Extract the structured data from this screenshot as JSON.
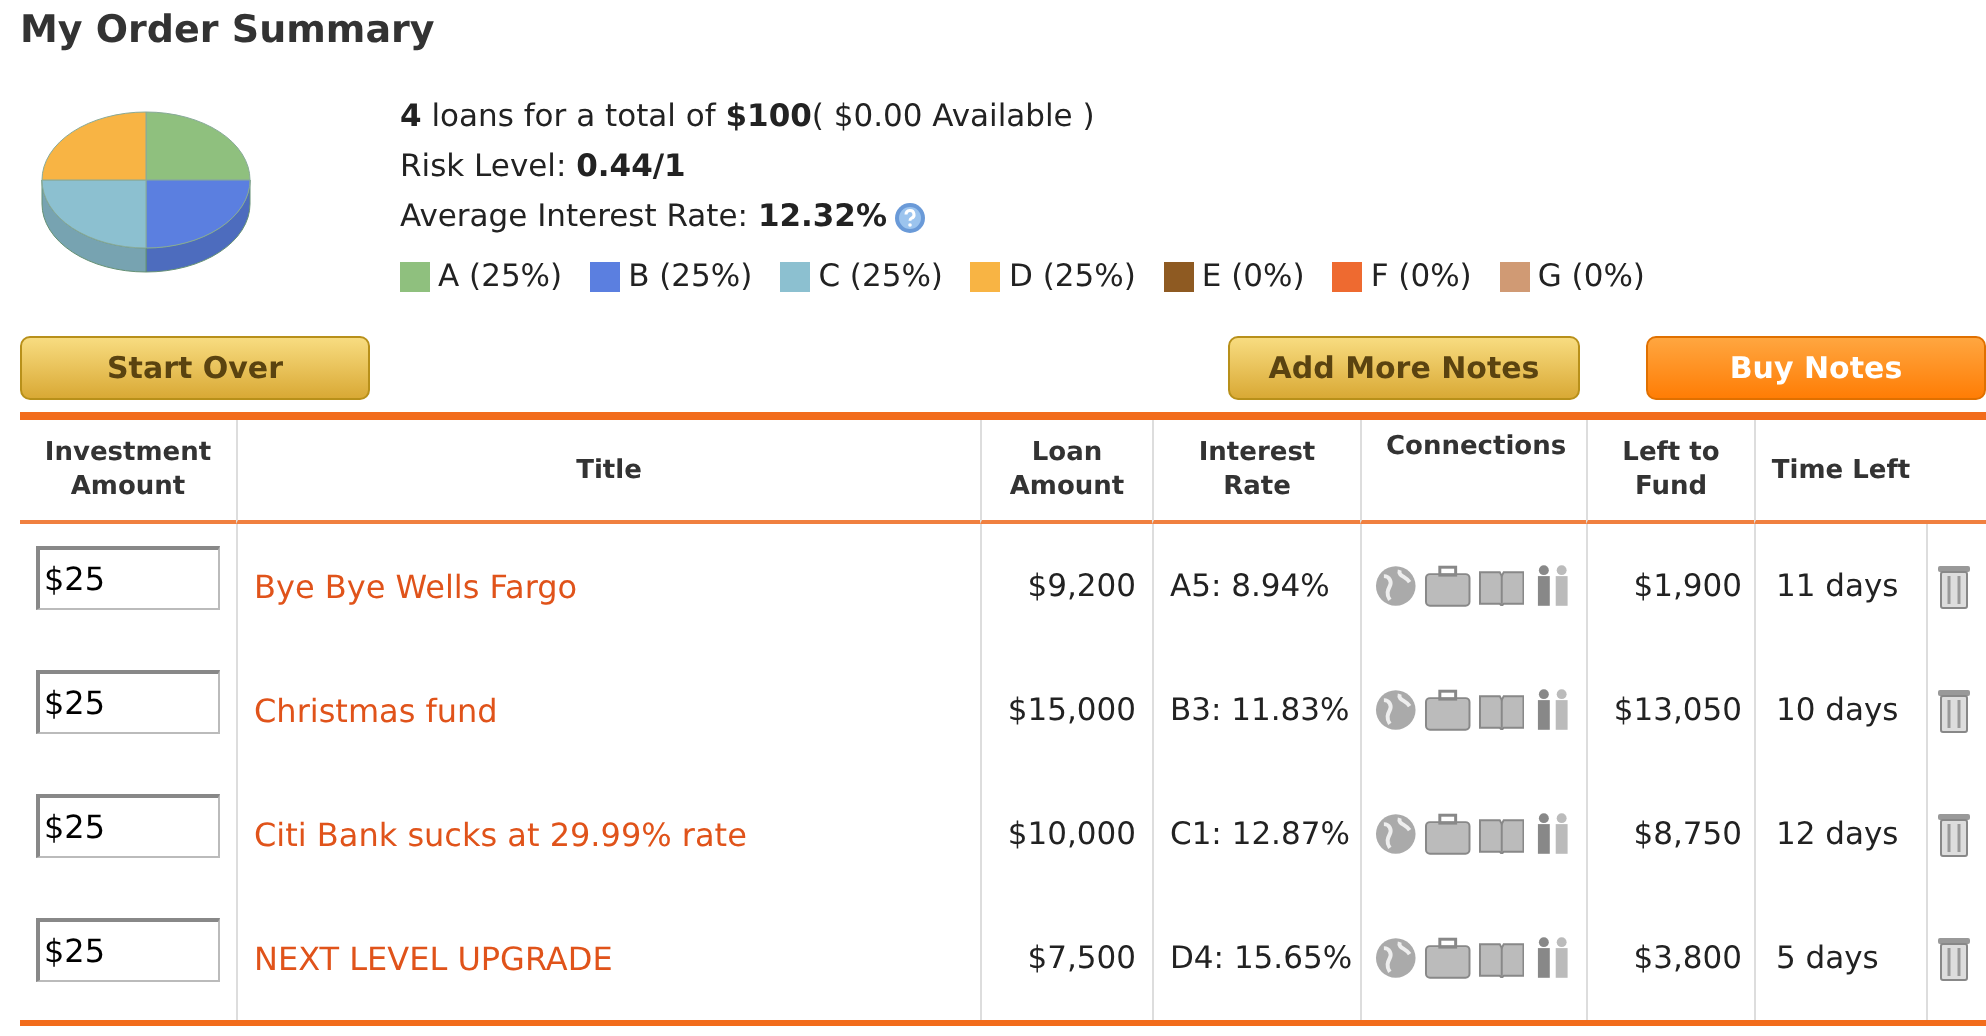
{
  "title": "My Order Summary",
  "summary": {
    "lines": [
      "**4** loans for a total of **$100**( $0.00 Available )",
      "Risk Level: **0.44/1**",
      "Average Interest Rate: **12.32%**"
    ],
    "legend": [
      {
        "label": "A (25%)",
        "color": "#8fc07e"
      },
      {
        "label": "B (25%)",
        "color": "#5b7fe0"
      },
      {
        "label": "C (25%)",
        "color": "#8cc0d0"
      },
      {
        "label": "D (25%)",
        "color": "#f8b444"
      },
      {
        "label": "E (0%)",
        "color": "#8e5a22"
      },
      {
        "label": "F (0%)",
        "color": "#ee6a30"
      },
      {
        "label": "G (0%)",
        "color": "#d09a74"
      }
    ]
  },
  "buttons": [
    {
      "label": "Start Over",
      "kind": "secondary"
    },
    {
      "label": "Add More Notes",
      "kind": "secondary"
    },
    {
      "label": "Buy Notes",
      "kind": "primary"
    }
  ],
  "table": {
    "columns": [
      "Investment Amount",
      "Title",
      "Loan Amount",
      "Interest Rate",
      "Connections",
      "Left to Fund",
      "Time Left"
    ],
    "rows": [
      {
        "investment": "$25",
        "title": "Bye Bye Wells Fargo",
        "loan_amount": "$9,200",
        "interest_rate": "A5: 8.94%",
        "left_to_fund": "$1,900",
        "time_left": "11 days"
      },
      {
        "investment": "$25",
        "title": "Christmas fund",
        "loan_amount": "$15,000",
        "interest_rate": "B3: 11.83%",
        "left_to_fund": "$13,050",
        "time_left": "10 days"
      },
      {
        "investment": "$25",
        "title": "Citi Bank sucks at 29.99% rate",
        "loan_amount": "$10,000",
        "interest_rate": "C1: 12.87%",
        "left_to_fund": "$8,750",
        "time_left": "12 days"
      },
      {
        "investment": "$25",
        "title": "NEXT LEVEL UPGRADE",
        "loan_amount": "$7,500",
        "interest_rate": "D4: 15.65%",
        "left_to_fund": "$3,800",
        "time_left": "5 days"
      }
    ]
  }
}
